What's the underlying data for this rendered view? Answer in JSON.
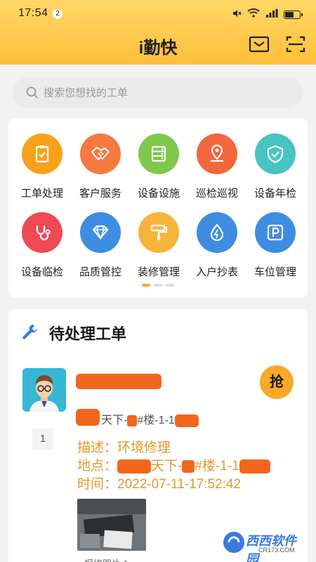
{
  "status_bar": {
    "time": "17:54",
    "notification_count": "2"
  },
  "header": {
    "title": "i勤快",
    "icons": [
      "mail-icon",
      "scan-icon"
    ]
  },
  "search": {
    "placeholder": "搜索您想找的工单"
  },
  "functions": [
    {
      "label": "工单处理",
      "icon": "clipboard-icon",
      "color": "#f7a21b"
    },
    {
      "label": "客户服务",
      "icon": "handshake-icon",
      "color": "#f47a40"
    },
    {
      "label": "设备设施",
      "icon": "server-icon",
      "color": "#7ec84b"
    },
    {
      "label": "巡检巡视",
      "icon": "location-icon",
      "color": "#f2673c"
    },
    {
      "label": "设备年检",
      "icon": "shield-check-icon",
      "color": "#48c4c2"
    },
    {
      "label": "设备临检",
      "icon": "stethoscope-icon",
      "color": "#ee4955"
    },
    {
      "label": "品质管控",
      "icon": "diamond-icon",
      "color": "#3f8de0"
    },
    {
      "label": "装修管理",
      "icon": "paint-roller-icon",
      "color": "#f7b43b"
    },
    {
      "label": "入户抄表",
      "icon": "water-drop-icon",
      "color": "#3f8de0"
    },
    {
      "label": "车位管理",
      "icon": "parking-icon",
      "color": "#3f8de0"
    }
  ],
  "page_dots": {
    "total": 3,
    "active": 1
  },
  "pending": {
    "title": "待处理工单",
    "order": {
      "grab_label": "抢",
      "address_fragment_1": "天下-",
      "address_fragment_2": "#楼-1-1",
      "count": "1",
      "description": "描述：环境修理",
      "location_prefix": "地点：",
      "location_fragment_1": "天下-",
      "location_fragment_2": "#楼-1-1",
      "time": "时间：2022-07-11-17:52:42",
      "photo_caption": "报修图片 1"
    }
  },
  "watermark": {
    "text": "西西软件园",
    "sub": "CR173.COM"
  },
  "colors": {
    "accent": "#ffbf3a",
    "detail_text": "#e29a2c",
    "grab": "#f7a927"
  }
}
